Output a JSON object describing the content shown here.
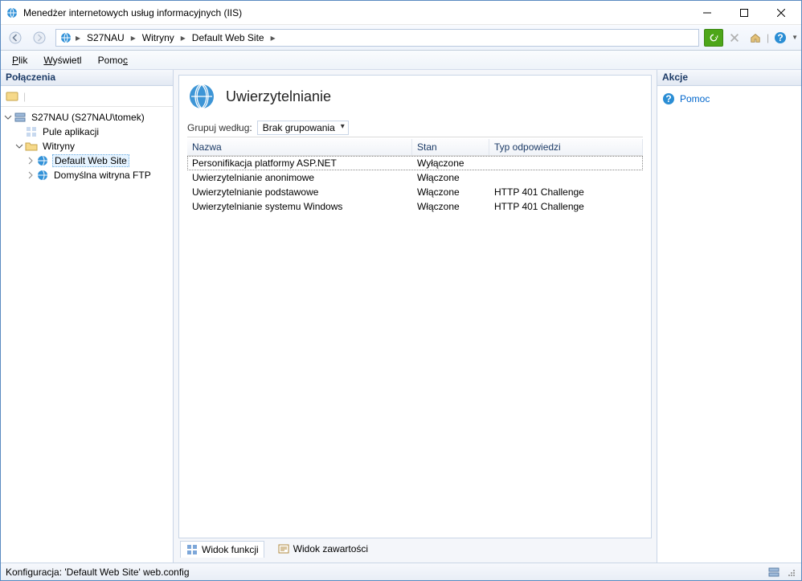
{
  "window": {
    "title": "Menedżer internetowych usług informacyjnych (IIS)"
  },
  "breadcrumb": {
    "server": "S27NAU",
    "sites": "Witryny",
    "site": "Default Web Site"
  },
  "menu": {
    "file": "Plik",
    "view": "Wyświetl",
    "help": "Pomoc"
  },
  "left": {
    "title": "Połączenia",
    "server": "S27NAU (S27NAU\\tomek)",
    "appPools": "Pule aplikacji",
    "sites": "Witryny",
    "defaultSite": "Default Web Site",
    "ftpSite": "Domyślna witryna FTP"
  },
  "feature": {
    "title": "Uwierzytelnianie",
    "groupLabel": "Grupuj według:",
    "groupValue": "Brak grupowania",
    "columns": {
      "name": "Nazwa",
      "state": "Stan",
      "resp": "Typ odpowiedzi"
    },
    "rows": [
      {
        "name": "Personifikacja platformy ASP.NET",
        "state": "Wyłączone",
        "resp": ""
      },
      {
        "name": "Uwierzytelnianie anonimowe",
        "state": "Włączone",
        "resp": ""
      },
      {
        "name": "Uwierzytelnianie podstawowe",
        "state": "Włączone",
        "resp": "HTTP 401 Challenge"
      },
      {
        "name": "Uwierzytelnianie systemu Windows",
        "state": "Włączone",
        "resp": "HTTP 401 Challenge"
      }
    ]
  },
  "tabs": {
    "features": "Widok funkcji",
    "content": "Widok zawartości"
  },
  "right": {
    "title": "Akcje",
    "help": "Pomoc"
  },
  "status": {
    "config": "Konfiguracja: 'Default Web Site' web.config"
  }
}
